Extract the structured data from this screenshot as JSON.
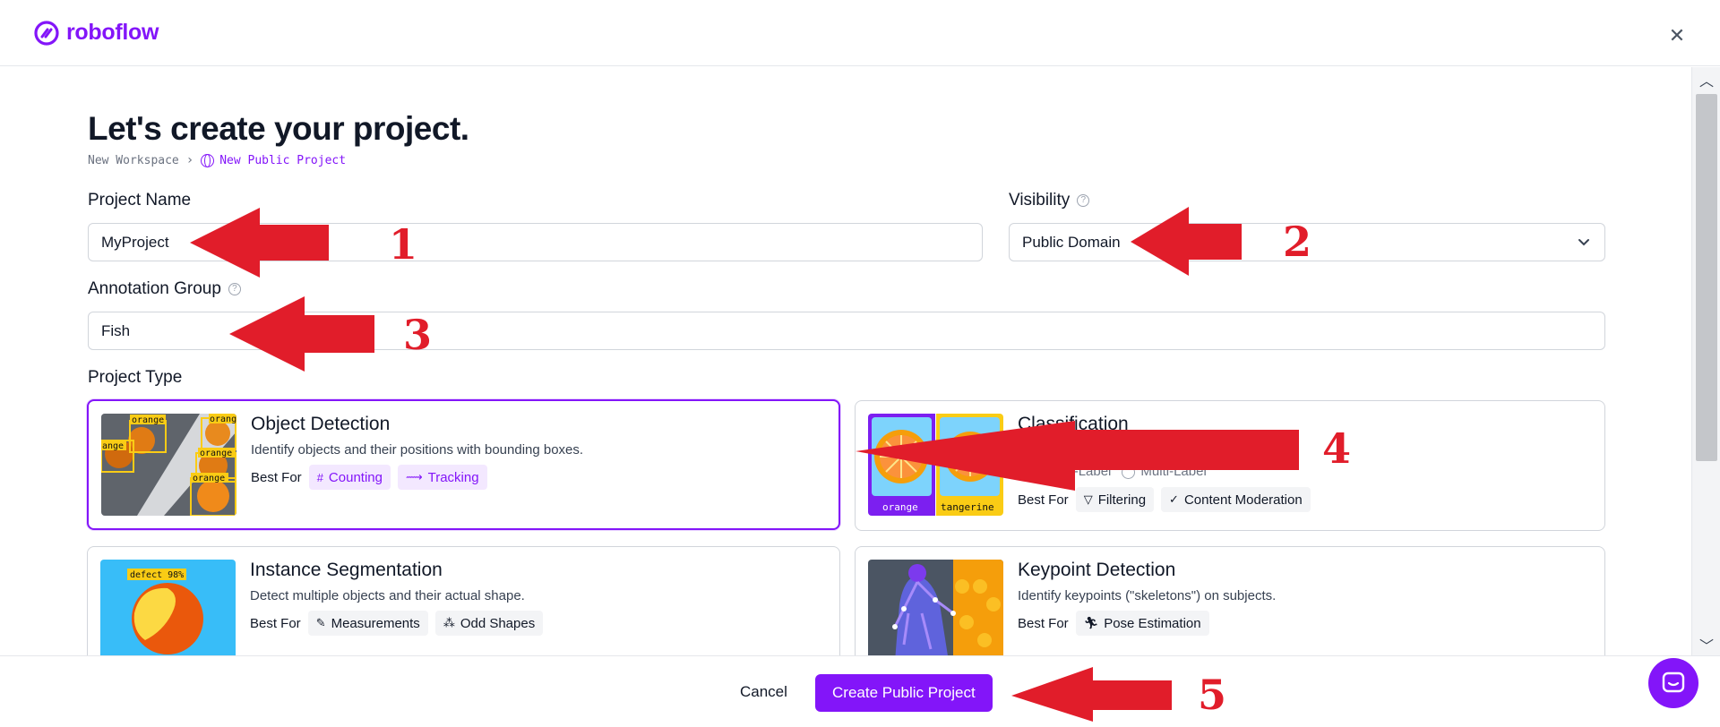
{
  "app": {
    "logo_text": "roboflow",
    "brand_color": "#8315f9"
  },
  "page": {
    "title": "Let's create your project.",
    "breadcrumb": {
      "workspace": "New Workspace",
      "current": "New Public Project"
    }
  },
  "form": {
    "project_name": {
      "label": "Project Name",
      "value": "MyProject"
    },
    "visibility": {
      "label": "Visibility",
      "value": "Public Domain"
    },
    "annotation_group": {
      "label": "Annotation Group",
      "value": "Fish"
    },
    "project_type_label": "Project Type"
  },
  "project_types": [
    {
      "title": "Object Detection",
      "description": "Identify objects and their positions with bounding boxes.",
      "best_for_label": "Best For",
      "tags": [
        "Counting",
        "Tracking"
      ],
      "selected": true,
      "thumb_labels": [
        "orange",
        "orange",
        "ange",
        "orange",
        "orange"
      ]
    },
    {
      "title": "Classification",
      "radio_options": [
        "Single-Label",
        "Multi-Label"
      ],
      "best_for_label": "Best For",
      "tags": [
        "Filtering",
        "Content Moderation"
      ],
      "selected": false,
      "thumb_labels": [
        "orange",
        "tangerine"
      ]
    },
    {
      "title": "Instance Segmentation",
      "description": "Detect multiple objects and their actual shape.",
      "best_for_label": "Best For",
      "tags": [
        "Measurements",
        "Odd Shapes"
      ],
      "selected": false,
      "thumb_labels": [
        "defect 98%"
      ]
    },
    {
      "title": "Keypoint Detection",
      "description": "Identify keypoints (\"skeletons\") on subjects.",
      "best_for_label": "Best For",
      "tags": [
        "Pose Estimation"
      ],
      "selected": false
    }
  ],
  "footer": {
    "cancel_label": "Cancel",
    "create_label": "Create Public Project"
  },
  "annotations": {
    "numbers": [
      "1",
      "2",
      "3",
      "4",
      "5"
    ],
    "color": "#e11d2a"
  }
}
